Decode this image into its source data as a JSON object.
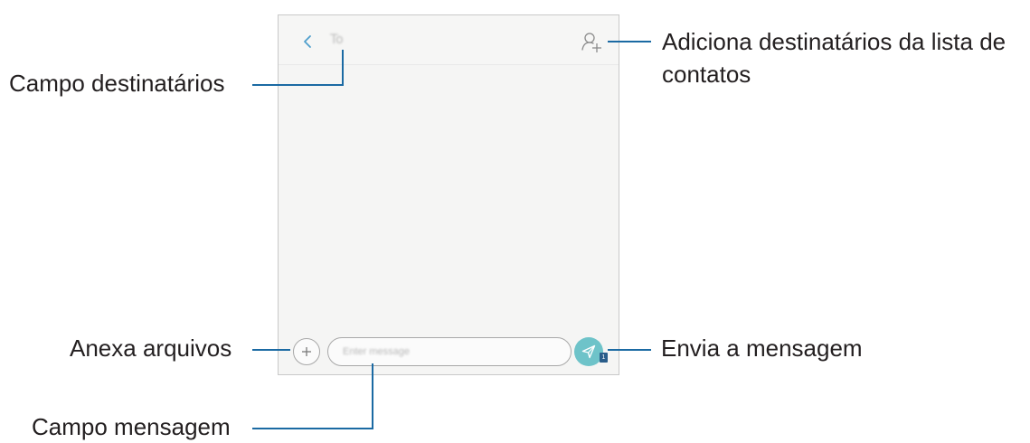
{
  "screen": {
    "to_label": "To",
    "message_placeholder": "Enter message",
    "sim_badge": "1"
  },
  "callouts": {
    "recipients_field": "Campo destinatários",
    "add_recipients_line1": "Adiciona destinatários da lista de",
    "add_recipients_line2": "contatos",
    "attach_files": "Anexa arquivos",
    "send_message": "Envia a mensagem",
    "message_field": "Campo mensagem"
  },
  "colors": {
    "callout_line": "#1b6aa3",
    "send_button": "#6ec3c9",
    "icon_accent": "#5aa9cc"
  }
}
